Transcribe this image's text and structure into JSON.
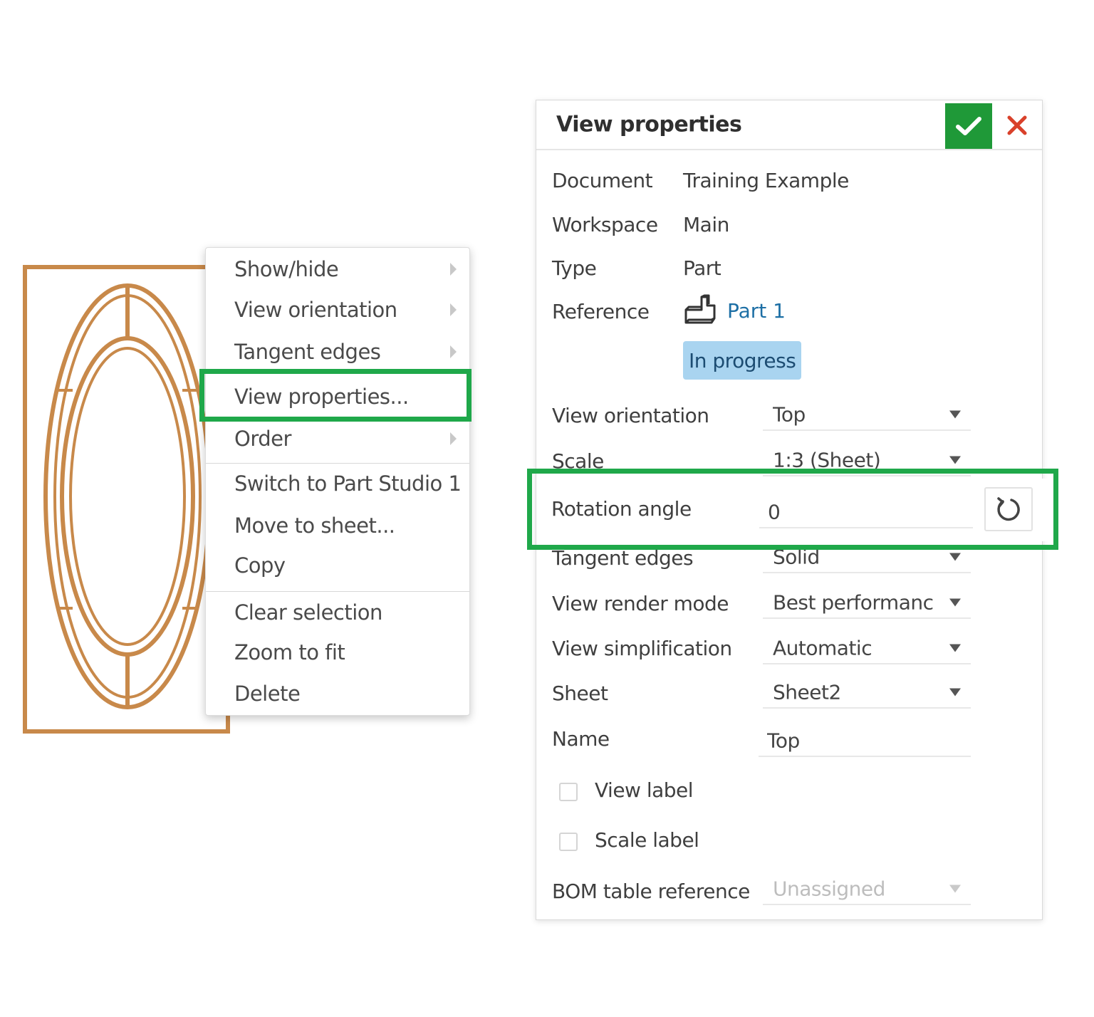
{
  "context_menu": {
    "items": [
      {
        "label": "Show/hide"
      },
      {
        "label": "View orientation"
      },
      {
        "label": "Tangent edges"
      },
      {
        "label": "View properties..."
      },
      {
        "label": "Order"
      },
      {
        "label": "Switch to Part Studio 1"
      },
      {
        "label": "Move to sheet..."
      },
      {
        "label": "Copy"
      },
      {
        "label": "Clear selection"
      },
      {
        "label": "Zoom to fit"
      },
      {
        "label": "Delete"
      }
    ]
  },
  "dialog": {
    "title": "View properties",
    "info": {
      "document_label": "Document",
      "document_value": "Training Example",
      "workspace_label": "Workspace",
      "workspace_value": "Main",
      "type_label": "Type",
      "type_value": "Part",
      "reference_label": "Reference",
      "reference_value": "Part 1",
      "status": "In progress"
    },
    "properties": {
      "view_orientation_label": "View orientation",
      "view_orientation_value": "Top",
      "scale_label": "Scale",
      "scale_value": "1:3 (Sheet)",
      "rotation_label": "Rotation angle",
      "rotation_value": "0",
      "tangent_edges_label": "Tangent edges",
      "tangent_edges_value": "Solid",
      "render_mode_label": "View render mode",
      "render_mode_value": "Best performanc",
      "simplification_label": "View simplification",
      "simplification_value": "Automatic",
      "sheet_label": "Sheet",
      "sheet_value": "Sheet2",
      "name_label": "Name",
      "name_value": "Top",
      "view_label_checkbox": "View label",
      "scale_label_checkbox": "Scale label",
      "bom_label": "BOM table reference",
      "bom_placeholder": "Unassigned"
    }
  },
  "colors": {
    "highlight": "#1fa84a",
    "ok_button": "#1f9938",
    "cancel_icon": "#d9412b",
    "link": "#1d6fa5",
    "status_badge": "#a9d4f0",
    "drawing_stroke": "#c8894a"
  }
}
